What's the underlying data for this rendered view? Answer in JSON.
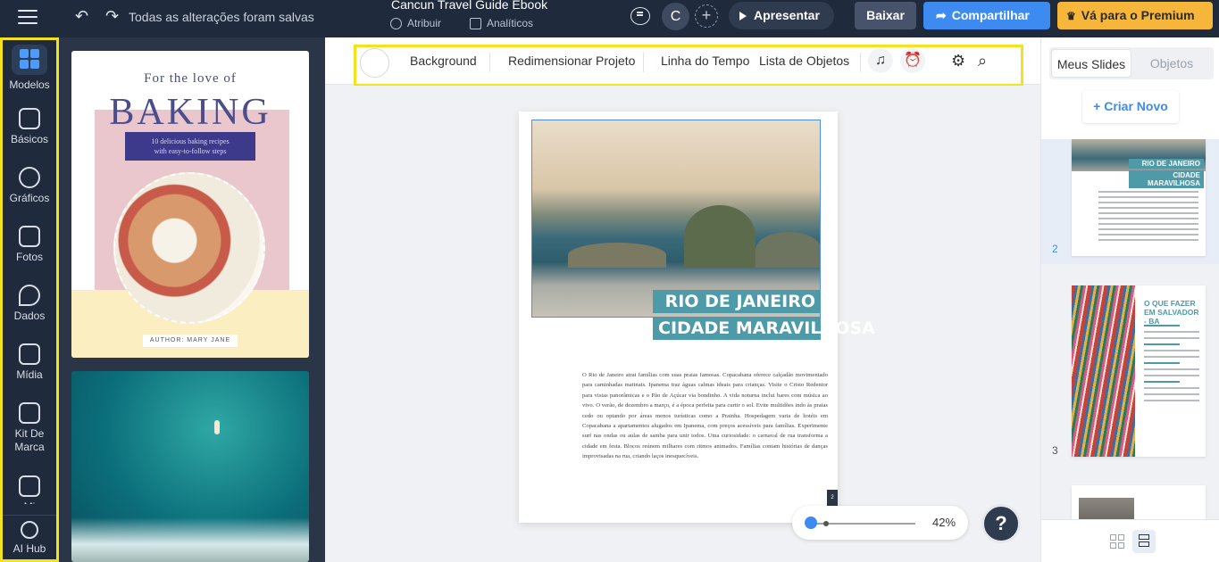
{
  "topbar": {
    "save_status": "Todas as alterações foram salvas",
    "doc_title": "Cancun Travel Guide Ebook",
    "assign_label": "Atribuir",
    "analytics_label": "Analíticos",
    "avatar_initial": "C",
    "present_label": "Apresentar",
    "download_label": "Baixar",
    "share_label": "Compartilhar",
    "premium_label": "Vá para o Premium"
  },
  "leftnav": {
    "items": [
      {
        "label": "Modelos",
        "icon": "templates-grid-icon"
      },
      {
        "label": "Básicos",
        "icon": "text-icon"
      },
      {
        "label": "Gráficos",
        "icon": "graphics-icon"
      },
      {
        "label": "Fotos",
        "icon": "photos-icon"
      },
      {
        "label": "Dados",
        "icon": "pie-chart-icon"
      },
      {
        "label": "Mídia",
        "icon": "media-icon"
      },
      {
        "label": "Kit De Marca",
        "icon": "brand-kit-icon"
      },
      {
        "label": "Mi",
        "icon": "folder-icon"
      },
      {
        "label": "AI Hub",
        "icon": "sparkle-icon"
      }
    ]
  },
  "templates": {
    "baking": {
      "eyebrow": "For the love of",
      "title": "BAKING",
      "subtitle_1": "10 delicious baking recipes",
      "subtitle_2": "with easy-to-follow steps",
      "author": "AUTHOR: MARY JANE"
    }
  },
  "toolbar": {
    "background": "Background",
    "resize": "Redimensionar Projeto",
    "timeline": "Linha do Tempo",
    "object_list": "Lista de Objetos"
  },
  "canvas": {
    "caption_line1": "RIO DE JANEIRO",
    "caption_line2": "CIDADE MARAVILHOSA",
    "body_text": "O Rio de Janeiro atrai famílias com suas praias famosas. Copacabana oferece calçadão movimentado para caminhadas matinais. Ipanema traz águas calmas ideais para crianças. Visite o Cristo Redentor para vistas panorâmicas e o Pão de Açúcar via bondinho. A vida noturna inclui bares com música ao vivo. O verão, de dezembro a março, é a época perfeita para curtir o sol. Evite multidões indo às praias cedo ou optando por áreas menos turísticas como a Prainha. Hospedagem varia de hotéis em Copacabana a apartamentos alugados em Ipanema, com preços acessíveis para famílias. Experimente surf nas ondas ou aulas de samba para unir todos. Uma curiosidade: o carnaval de rua transforma a cidade em festa. Blocos reúnem milhares com ritmos animados. Famílias contam histórias de danças improvisadas na rua, criando laços inesquecíveis.",
    "page_tag": "2",
    "zoom": "42%",
    "help": "?"
  },
  "rightpanel": {
    "tab_my_slides": "Meus Slides",
    "tab_objects": "Objetos",
    "create_new": "+ Criar Novo",
    "slides": [
      {
        "number": "2",
        "caption1": "RIO DE JANEIRO",
        "caption2": "CIDADE MARAVILHOSA"
      },
      {
        "number": "3",
        "title": "O QUE FAZER EM SALVADOR - BA"
      }
    ]
  },
  "colors": {
    "topbar": "#1f2b3d",
    "accent_blue": "#3d8bf0",
    "premium": "#f6b63a",
    "highlight": "#f3e21c",
    "caption_teal": "#4e9aa8"
  }
}
